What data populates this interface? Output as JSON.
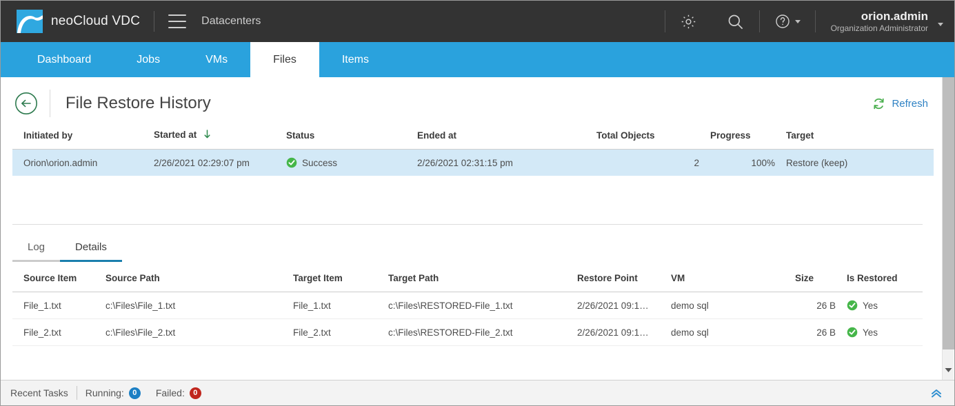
{
  "topbar": {
    "logo_icon": "cloud-swoosh-logo",
    "brand": "neoCloud VDC",
    "menu_icon": "hamburger-menu-icon",
    "context_label": "Datacenters",
    "settings_icon": "gear-icon",
    "search_icon": "search-icon",
    "help_icon": "help-circle-icon",
    "user_name": "orion.admin",
    "user_role": "Organization Administrator",
    "user_chevron_icon": "chevron-down-icon",
    "accent_color": "#2aa2dd",
    "bar_color": "#333333"
  },
  "nav": {
    "tabs": [
      {
        "label": "Dashboard",
        "active": false
      },
      {
        "label": "Jobs",
        "active": false
      },
      {
        "label": "VMs",
        "active": false
      },
      {
        "label": "Files",
        "active": true
      },
      {
        "label": "Items",
        "active": false
      }
    ]
  },
  "page": {
    "back_icon": "back-arrow-circle-icon",
    "title": "File Restore History",
    "refresh_icon": "refresh-icon",
    "refresh_label": "Refresh"
  },
  "master_table": {
    "columns": [
      "Initiated by",
      "Started at",
      "Status",
      "Ended at",
      "Total Objects",
      "Progress",
      "Target"
    ],
    "sort": {
      "column": "Started at",
      "direction": "descending",
      "icon": "sort-down-arrow-icon",
      "color": "#2f8a4e"
    },
    "rows": [
      {
        "selected": true,
        "initiated_by": "Orion\\orion.admin",
        "started_at": "2/26/2021 02:29:07 pm",
        "status": "Success",
        "status_icon": "success-check-icon",
        "ended_at": "2/26/2021 02:31:15 pm",
        "total_objects": "2",
        "progress": "100%",
        "target": "Restore (keep)"
      }
    ]
  },
  "subtabs": [
    {
      "label": "Log",
      "active": false
    },
    {
      "label": "Details",
      "active": true
    }
  ],
  "details_table": {
    "columns": [
      "Source Item",
      "Source Path",
      "Target Item",
      "Target Path",
      "Restore Point",
      "VM",
      "Size",
      "Is Restored"
    ],
    "rows": [
      {
        "source_item": "File_1.txt",
        "source_path": "c:\\Files\\File_1.txt",
        "target_item": "File_1.txt",
        "target_path": "c:\\Files\\RESTORED-File_1.txt",
        "restore_point": "2/26/2021 09:1…",
        "vm": "demo sql",
        "size": "26 B",
        "is_restored": "Yes",
        "is_restored_icon": "success-check-icon"
      },
      {
        "source_item": "File_2.txt",
        "source_path": "c:\\Files\\File_2.txt",
        "target_item": "File_2.txt",
        "target_path": "c:\\Files\\RESTORED-File_2.txt",
        "restore_point": "2/26/2021 09:1…",
        "vm": "demo sql",
        "size": "26 B",
        "is_restored": "Yes",
        "is_restored_icon": "success-check-icon"
      }
    ]
  },
  "statusbar": {
    "recent_tasks_label": "Recent Tasks",
    "running_label": "Running:",
    "running_count": "0",
    "running_color": "#1b7fc4",
    "failed_label": "Failed:",
    "failed_count": "0",
    "failed_color": "#c0261d",
    "collapse_icon": "double-chevron-up-icon"
  },
  "scrollbar": {
    "down_arrow_icon": "scroll-down-arrow-icon"
  }
}
